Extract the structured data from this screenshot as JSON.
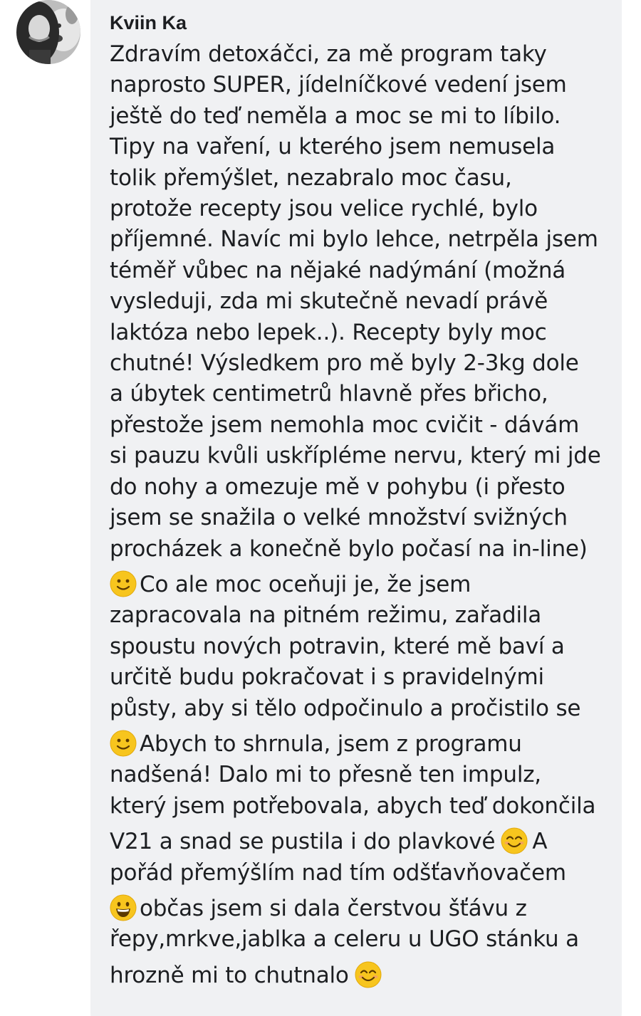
{
  "comment": {
    "author": "Kviin Ka",
    "lines": {
      "l1": "Zdravím detoxáčci, za mě program taky",
      "l2": "naprosto SUPER, jídelníčkové vedení jsem",
      "l3": "ještě do teď neměla a moc se mi to líbilo.",
      "l4": "Tipy na vaření, u kterého jsem nemusela",
      "l5": "tolik přemýšlet, nezabralo moc času,",
      "l6": "protože recepty jsou velice rychlé, bylo",
      "l7": "příjemné. Navíc mi bylo lehce, netrpěla jsem",
      "l8": "téměř vůbec na nějaké nadýmání (možná",
      "l9": "vysleduji, zda mi skutečně nevadí právě",
      "l10": "laktóza nebo lepek..). Recepty byly moc",
      "l11": "chutné! Výsledkem pro mě byly 2-3kg dole",
      "l12": "a úbytek centimetrů hlavně přes břicho,",
      "l13": "přestože jsem nemohla moc cvičit - dávám",
      "l14": "si pauzu kvůli uskřípléme nervu, který mi jde",
      "l15": "do nohy a omezuje mě v pohybu (i přesto",
      "l16": "jsem se snažila o velké množství svižných",
      "l17": "procházek a konečně bylo počasí na in-line)",
      "l18": "Co ale moc oceňuji je, že jsem",
      "l19": "zapracovala na pitném režimu, zařadila",
      "l20": "spoustu nových potravin, které mě baví a",
      "l21": "určitě budu pokračovat i s pravidelnými",
      "l22": "půsty, aby si tělo odpočinulo a pročistilo se",
      "l23": "Abych to shrnula, jsem z programu",
      "l24": "nadšená! Dalo mi to přesně ten impulz,",
      "l25": "který jsem potřebovala, abych teď dokončila",
      "l26a": "V21 a snad se pustila i do plavkové",
      "l26b": "A",
      "l27": "pořád přemýšlím nad tím odšťavňovačem",
      "l28": "občas jsem si dala čerstvou šťávu z",
      "l29": "řepy,mrkve,jablka a celeru u UGO stánku a",
      "l30": "hrozně mi to chutnalo"
    },
    "emoji": [
      "slightly-smiling",
      "slightly-smiling",
      "smiling-eyes",
      "grinning",
      "smiling-eyes"
    ]
  },
  "colors": {
    "bubble": "#f0f1f3",
    "text": "#1c1e21",
    "emoji_face": "#f7c51e",
    "emoji_feature": "#5b3a00"
  }
}
